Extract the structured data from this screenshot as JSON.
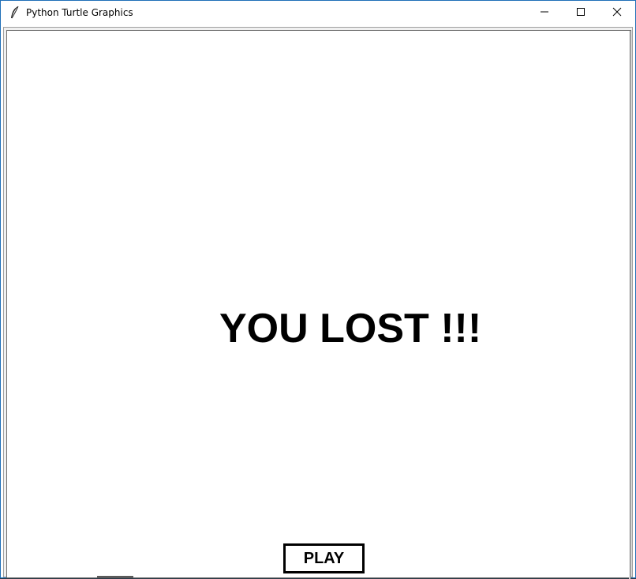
{
  "window": {
    "title": "Python Turtle Graphics",
    "icons": {
      "app": "feather-icon",
      "minimize": "minimize-icon",
      "maximize": "maximize-icon",
      "close": "close-icon"
    },
    "border_color": "#1f6fb8"
  },
  "game": {
    "message": "YOU LOST !!!",
    "play_button_label": "PLAY",
    "background_color": "#ffffff",
    "text_color": "#000000"
  }
}
